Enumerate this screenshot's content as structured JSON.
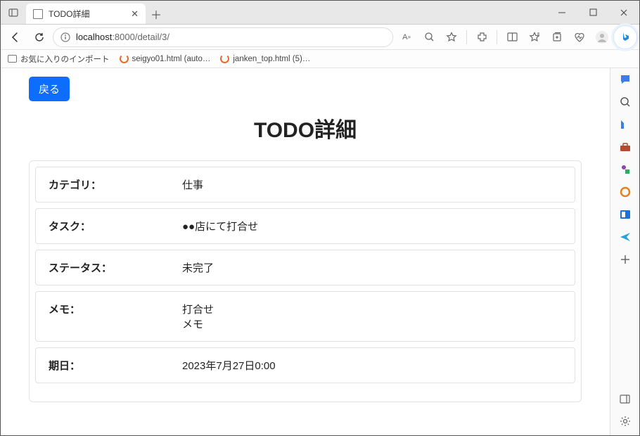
{
  "browser": {
    "tab_title": "TODO詳細",
    "url_prefix": "localhost",
    "url_rest": ":8000/detail/3/"
  },
  "bookmarks": {
    "import_label": "お気に入りのインポート",
    "items": [
      {
        "label": "seigyo01.html (auto…"
      },
      {
        "label": "janken_top.html (5)…"
      }
    ]
  },
  "page": {
    "back_button": "戻る",
    "title": "TODO詳細",
    "rows": [
      {
        "label": "カテゴリ：",
        "value": "仕事"
      },
      {
        "label": "タスク：",
        "value": "●●店にて打合せ"
      },
      {
        "label": "ステータス：",
        "value": "未完了"
      },
      {
        "label": "メモ：",
        "value": "打合せ\nメモ"
      },
      {
        "label": "期日：",
        "value": "2023年7月27日0:00"
      }
    ]
  }
}
